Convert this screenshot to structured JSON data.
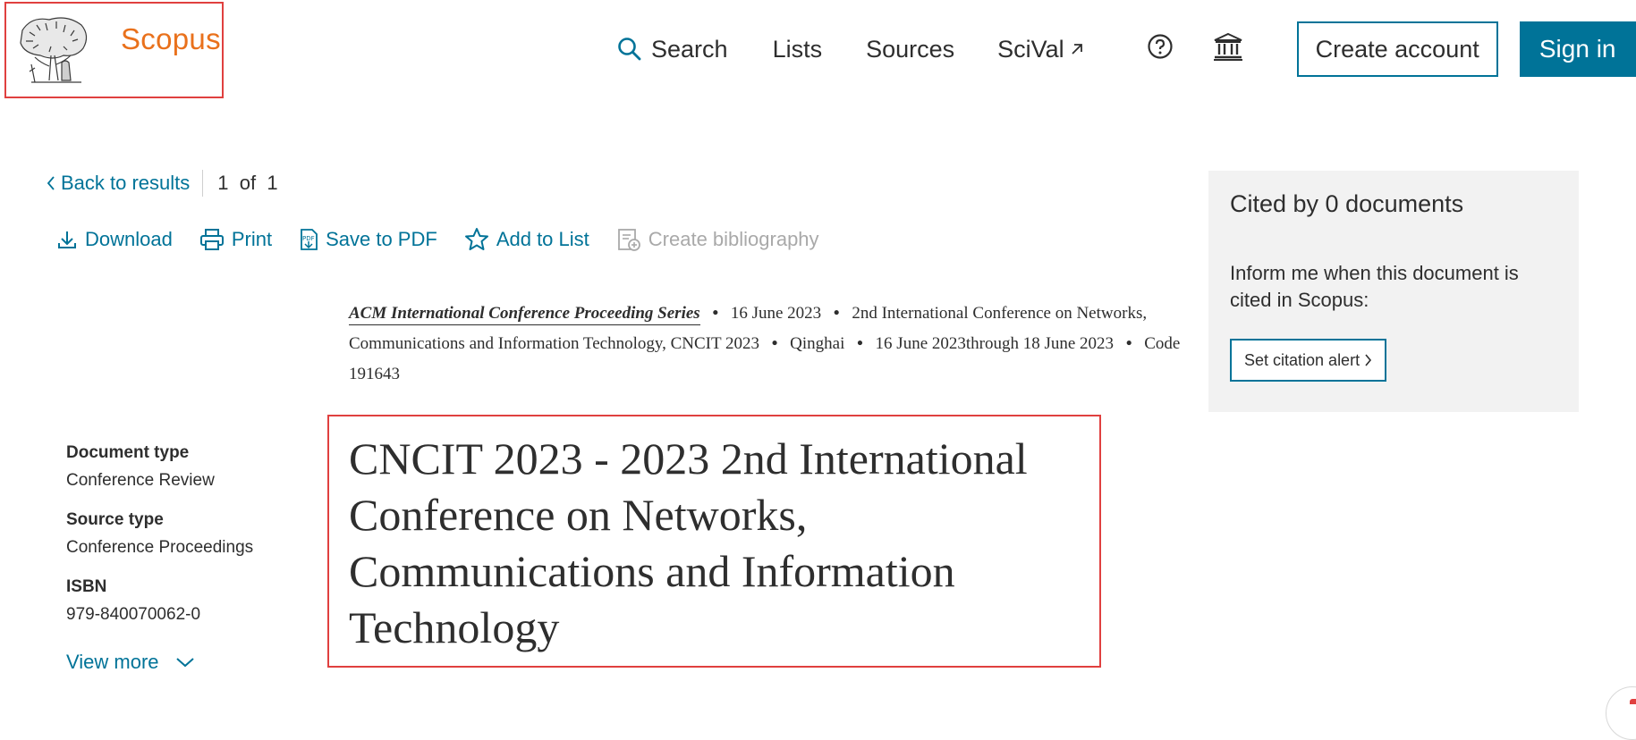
{
  "header": {
    "brand": "Scopus",
    "nav": {
      "search": "Search",
      "lists": "Lists",
      "sources": "Sources",
      "scival": "SciVal"
    },
    "create_account": "Create account",
    "sign_in": "Sign in"
  },
  "navigation": {
    "back": "Back to results",
    "pager": "1  of  1"
  },
  "actions": {
    "download": "Download",
    "print": "Print",
    "save_pdf": "Save to PDF",
    "add_list": "Add to List",
    "create_bib": "Create bibliography"
  },
  "source": {
    "series": "ACM International Conference Proceeding Series",
    "date": "16 June 2023",
    "conference": "2nd International Conference on Networks, Communications and Information Technology, CNCIT 2023",
    "location": "Qinghai",
    "dates_range": "16 June 2023through 18 June 2023",
    "code": "Code 191643"
  },
  "document": {
    "title": "CNCIT 2023 - 2023 2nd International Conference on Networks, Communications and Information Technology",
    "type_label": "Document type",
    "type_value": "Conference Review",
    "source_type_label": "Source type",
    "source_type_value": "Conference Proceedings",
    "isbn_label": "ISBN",
    "isbn_value": "979-840070062-0",
    "view_more": "View more"
  },
  "cited": {
    "title": "Cited by 0 documents",
    "inform": "Inform me when this document is cited in Scopus:",
    "alert_button": "Set citation alert"
  },
  "colors": {
    "brand_orange": "#e9711c",
    "link_blue": "#007398",
    "highlight_red": "#e0403f",
    "panel_gray": "#f2f2f2"
  }
}
